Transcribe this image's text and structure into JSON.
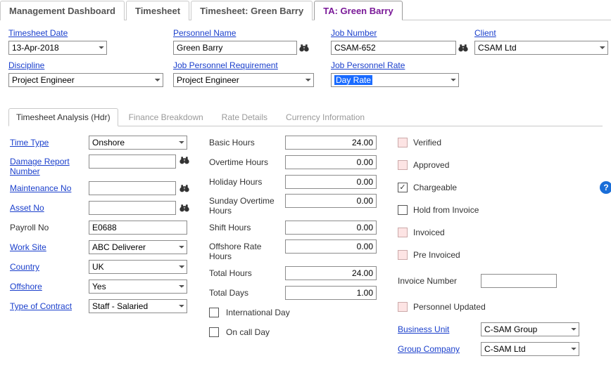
{
  "topTabs": {
    "management": "Management Dashboard",
    "timesheet": "Timesheet",
    "tsGreen": "Timesheet: Green Barry",
    "taGreen": "TA: Green Barry"
  },
  "header": {
    "timesheetDate": {
      "label": "Timesheet Date",
      "value": "13-Apr-2018"
    },
    "personnelName": {
      "label": "Personnel Name",
      "value": "Green Barry"
    },
    "jobNumber": {
      "label": "Job Number",
      "value": "CSAM-652"
    },
    "client": {
      "label": "Client",
      "value": "CSAM Ltd"
    },
    "discipline": {
      "label": "Discipline",
      "value": "Project Engineer"
    },
    "jobPersonnelReq": {
      "label": "Job Personnel Requirement",
      "value": "Project Engineer"
    },
    "jobPersonnelRate": {
      "label": "Job Personnel Rate",
      "value": "Day Rate"
    }
  },
  "innerTabs": {
    "hdr": "Timesheet Analysis (Hdr)",
    "fin": "Finance Breakdown",
    "rate": "Rate Details",
    "cur": "Currency Information"
  },
  "col1": {
    "timeType": {
      "label": "Time Type",
      "value": "Onshore"
    },
    "damageReport": {
      "label": "Damage Report Number",
      "value": ""
    },
    "maintenance": {
      "label": "Maintenance No",
      "value": ""
    },
    "asset": {
      "label": "Asset No",
      "value": ""
    },
    "payroll": {
      "label": "Payroll No",
      "value": "E0688"
    },
    "workSite": {
      "label": "Work Site",
      "value": "ABC Deliverer"
    },
    "country": {
      "label": "Country",
      "value": "UK"
    },
    "offshore": {
      "label": "Offshore",
      "value": "Yes"
    },
    "typeOfContract": {
      "label": "Type of Contract",
      "value": "Staff - Salaried"
    }
  },
  "col2": {
    "basicHours": {
      "label": "Basic Hours",
      "value": "24.00"
    },
    "otHours": {
      "label": "Overtime Hours",
      "value": "0.00"
    },
    "holidayHours": {
      "label": "Holiday Hours",
      "value": "0.00"
    },
    "sundayOT": {
      "label": "Sunday Overtime Hours",
      "value": "0.00"
    },
    "shiftHours": {
      "label": "Shift Hours",
      "value": "0.00"
    },
    "offshoreRate": {
      "label": "Offshore Rate Hours",
      "value": "0.00"
    },
    "totalHours": {
      "label": "Total Hours",
      "value": "24.00"
    },
    "totalDays": {
      "label": "Total Days",
      "value": "1.00"
    },
    "intlDay": "International Day",
    "onCallDay": "On call Day"
  },
  "col3": {
    "verified": "Verified",
    "approved": "Approved",
    "chargeable": "Chargeable",
    "holdInvoice": "Hold from Invoice",
    "invoiced": "Invoiced",
    "preInvoiced": "Pre Invoiced",
    "invoiceNumber": {
      "label": "Invoice Number",
      "value": ""
    },
    "personnelUpdated": "Personnel Updated",
    "businessUnit": {
      "label": "Business Unit",
      "value": "C-SAM Group"
    },
    "groupCompany": {
      "label": "Group Company",
      "value": "C-SAM Ltd"
    }
  },
  "icons": {
    "binoculars": "binoculars-icon",
    "help": "?"
  }
}
